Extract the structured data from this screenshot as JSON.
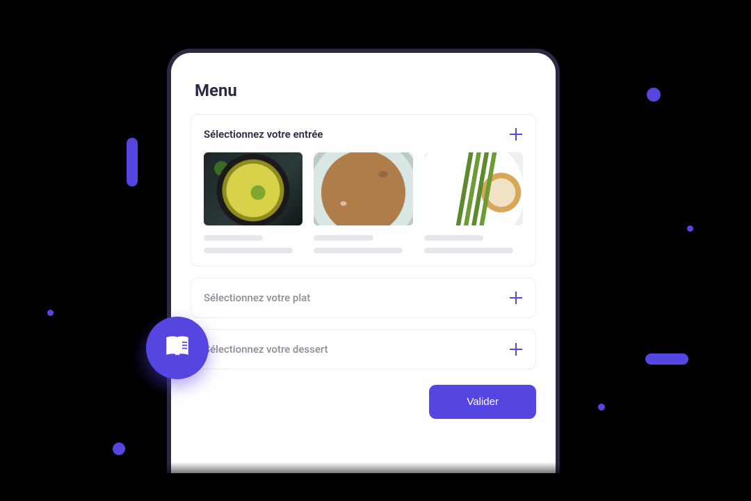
{
  "colors": {
    "accent": "#5546e2"
  },
  "title": "Menu",
  "sections": {
    "entree": {
      "title": "Sélectionnez votre entrée",
      "expanded": true
    },
    "plat": {
      "title": "Sélectionnez votre plat",
      "expanded": false
    },
    "dessert": {
      "title": "Sélectionnez votre dessert",
      "expanded": false
    }
  },
  "actions": {
    "validate_label": "Valider"
  },
  "icons": {
    "plus": "plus-icon",
    "book": "menu-book-icon"
  }
}
